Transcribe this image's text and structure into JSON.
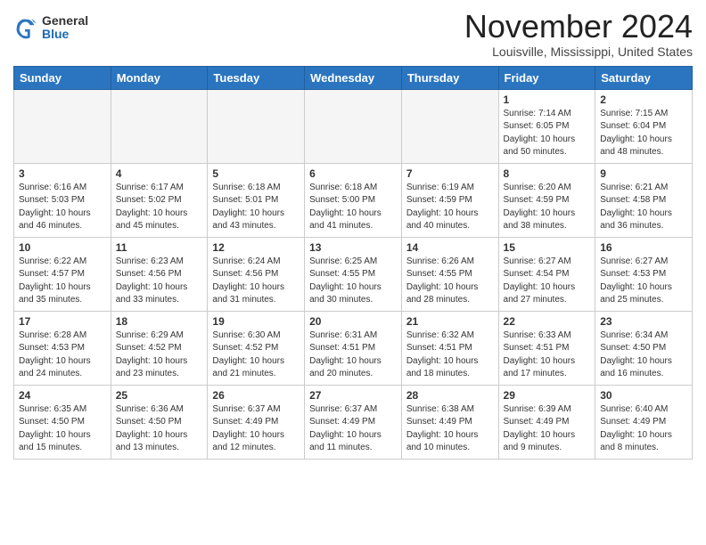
{
  "header": {
    "logo_general": "General",
    "logo_blue": "Blue",
    "month": "November 2024",
    "location": "Louisville, Mississippi, United States"
  },
  "weekdays": [
    "Sunday",
    "Monday",
    "Tuesday",
    "Wednesday",
    "Thursday",
    "Friday",
    "Saturday"
  ],
  "weeks": [
    [
      {
        "day": "",
        "info": ""
      },
      {
        "day": "",
        "info": ""
      },
      {
        "day": "",
        "info": ""
      },
      {
        "day": "",
        "info": ""
      },
      {
        "day": "",
        "info": ""
      },
      {
        "day": "1",
        "info": "Sunrise: 7:14 AM\nSunset: 6:05 PM\nDaylight: 10 hours\nand 50 minutes."
      },
      {
        "day": "2",
        "info": "Sunrise: 7:15 AM\nSunset: 6:04 PM\nDaylight: 10 hours\nand 48 minutes."
      }
    ],
    [
      {
        "day": "3",
        "info": "Sunrise: 6:16 AM\nSunset: 5:03 PM\nDaylight: 10 hours\nand 46 minutes."
      },
      {
        "day": "4",
        "info": "Sunrise: 6:17 AM\nSunset: 5:02 PM\nDaylight: 10 hours\nand 45 minutes."
      },
      {
        "day": "5",
        "info": "Sunrise: 6:18 AM\nSunset: 5:01 PM\nDaylight: 10 hours\nand 43 minutes."
      },
      {
        "day": "6",
        "info": "Sunrise: 6:18 AM\nSunset: 5:00 PM\nDaylight: 10 hours\nand 41 minutes."
      },
      {
        "day": "7",
        "info": "Sunrise: 6:19 AM\nSunset: 4:59 PM\nDaylight: 10 hours\nand 40 minutes."
      },
      {
        "day": "8",
        "info": "Sunrise: 6:20 AM\nSunset: 4:59 PM\nDaylight: 10 hours\nand 38 minutes."
      },
      {
        "day": "9",
        "info": "Sunrise: 6:21 AM\nSunset: 4:58 PM\nDaylight: 10 hours\nand 36 minutes."
      }
    ],
    [
      {
        "day": "10",
        "info": "Sunrise: 6:22 AM\nSunset: 4:57 PM\nDaylight: 10 hours\nand 35 minutes."
      },
      {
        "day": "11",
        "info": "Sunrise: 6:23 AM\nSunset: 4:56 PM\nDaylight: 10 hours\nand 33 minutes."
      },
      {
        "day": "12",
        "info": "Sunrise: 6:24 AM\nSunset: 4:56 PM\nDaylight: 10 hours\nand 31 minutes."
      },
      {
        "day": "13",
        "info": "Sunrise: 6:25 AM\nSunset: 4:55 PM\nDaylight: 10 hours\nand 30 minutes."
      },
      {
        "day": "14",
        "info": "Sunrise: 6:26 AM\nSunset: 4:55 PM\nDaylight: 10 hours\nand 28 minutes."
      },
      {
        "day": "15",
        "info": "Sunrise: 6:27 AM\nSunset: 4:54 PM\nDaylight: 10 hours\nand 27 minutes."
      },
      {
        "day": "16",
        "info": "Sunrise: 6:27 AM\nSunset: 4:53 PM\nDaylight: 10 hours\nand 25 minutes."
      }
    ],
    [
      {
        "day": "17",
        "info": "Sunrise: 6:28 AM\nSunset: 4:53 PM\nDaylight: 10 hours\nand 24 minutes."
      },
      {
        "day": "18",
        "info": "Sunrise: 6:29 AM\nSunset: 4:52 PM\nDaylight: 10 hours\nand 23 minutes."
      },
      {
        "day": "19",
        "info": "Sunrise: 6:30 AM\nSunset: 4:52 PM\nDaylight: 10 hours\nand 21 minutes."
      },
      {
        "day": "20",
        "info": "Sunrise: 6:31 AM\nSunset: 4:51 PM\nDaylight: 10 hours\nand 20 minutes."
      },
      {
        "day": "21",
        "info": "Sunrise: 6:32 AM\nSunset: 4:51 PM\nDaylight: 10 hours\nand 18 minutes."
      },
      {
        "day": "22",
        "info": "Sunrise: 6:33 AM\nSunset: 4:51 PM\nDaylight: 10 hours\nand 17 minutes."
      },
      {
        "day": "23",
        "info": "Sunrise: 6:34 AM\nSunset: 4:50 PM\nDaylight: 10 hours\nand 16 minutes."
      }
    ],
    [
      {
        "day": "24",
        "info": "Sunrise: 6:35 AM\nSunset: 4:50 PM\nDaylight: 10 hours\nand 15 minutes."
      },
      {
        "day": "25",
        "info": "Sunrise: 6:36 AM\nSunset: 4:50 PM\nDaylight: 10 hours\nand 13 minutes."
      },
      {
        "day": "26",
        "info": "Sunrise: 6:37 AM\nSunset: 4:49 PM\nDaylight: 10 hours\nand 12 minutes."
      },
      {
        "day": "27",
        "info": "Sunrise: 6:37 AM\nSunset: 4:49 PM\nDaylight: 10 hours\nand 11 minutes."
      },
      {
        "day": "28",
        "info": "Sunrise: 6:38 AM\nSunset: 4:49 PM\nDaylight: 10 hours\nand 10 minutes."
      },
      {
        "day": "29",
        "info": "Sunrise: 6:39 AM\nSunset: 4:49 PM\nDaylight: 10 hours\nand 9 minutes."
      },
      {
        "day": "30",
        "info": "Sunrise: 6:40 AM\nSunset: 4:49 PM\nDaylight: 10 hours\nand 8 minutes."
      }
    ]
  ]
}
